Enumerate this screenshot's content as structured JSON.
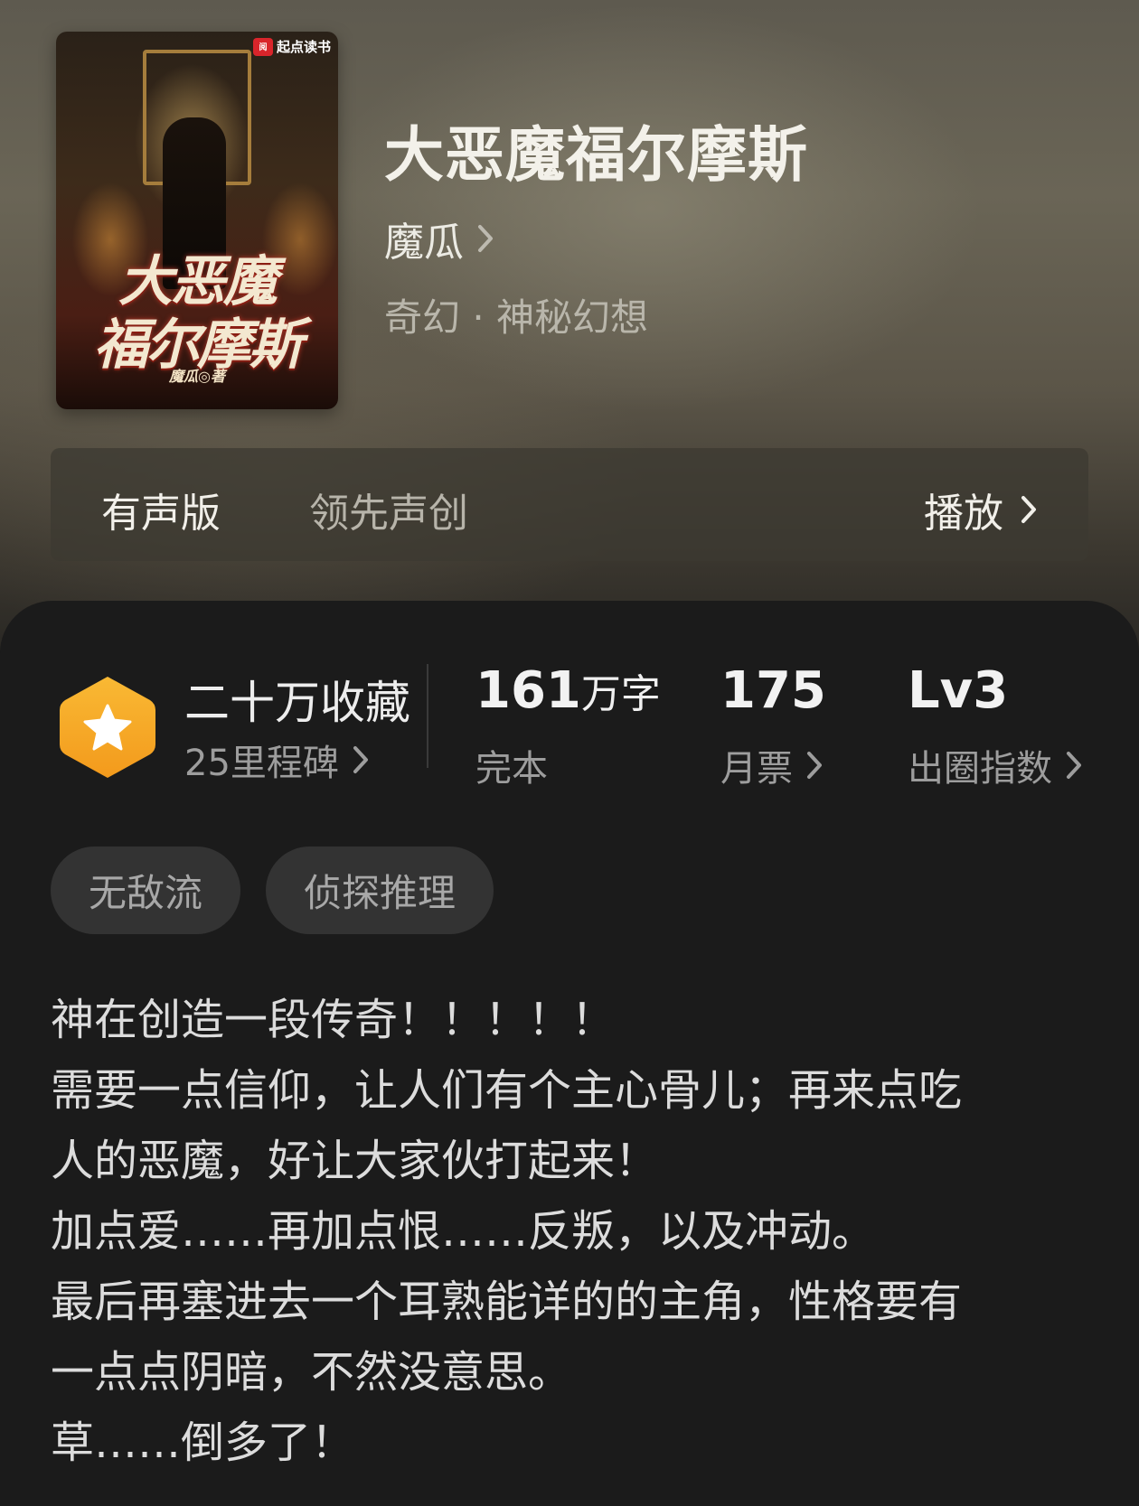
{
  "book": {
    "title": "大恶魔福尔摩斯",
    "author": "魔瓜",
    "genre": "奇幻 · 神秘幻想"
  },
  "cover": {
    "publisher": "起点读书",
    "publisher_logo": "阅",
    "title_line1": "大恶魔",
    "title_line2": "福尔摩斯",
    "author_credit": "魔瓜◎著"
  },
  "audio": {
    "label": "有声版",
    "subtitle": "领先声创",
    "play_label": "播放"
  },
  "stats": {
    "collection": {
      "title": "二十万收藏",
      "sub": "25里程碑"
    },
    "words": {
      "value": "161",
      "unit": "万字",
      "sub": "完本"
    },
    "monthly_votes": {
      "value": "175",
      "sub": "月票"
    },
    "popularity": {
      "value": "Lv3",
      "sub": "出圈指数"
    }
  },
  "tags": [
    "无敌流",
    "侦探推理"
  ],
  "intro_lines": [
    "神在创造一段传奇！！！！！",
    "需要一点信仰，让人们有个主心骨儿；再来点吃",
    "人的恶魔，好让大家伙打起来！",
    "加点爱……再加点恨……反叛，以及冲动。",
    "最后再塞进去一个耳熟能详的的主角，性格要有",
    "一点点阴暗，不然没意思。",
    "草……倒多了！"
  ],
  "colors": {
    "badge_orange": "#f5a623",
    "panel_bg": "#1b1b1b",
    "tag_bg": "#333333"
  },
  "icons": [
    "star-icon",
    "chevron-right-icon"
  ]
}
